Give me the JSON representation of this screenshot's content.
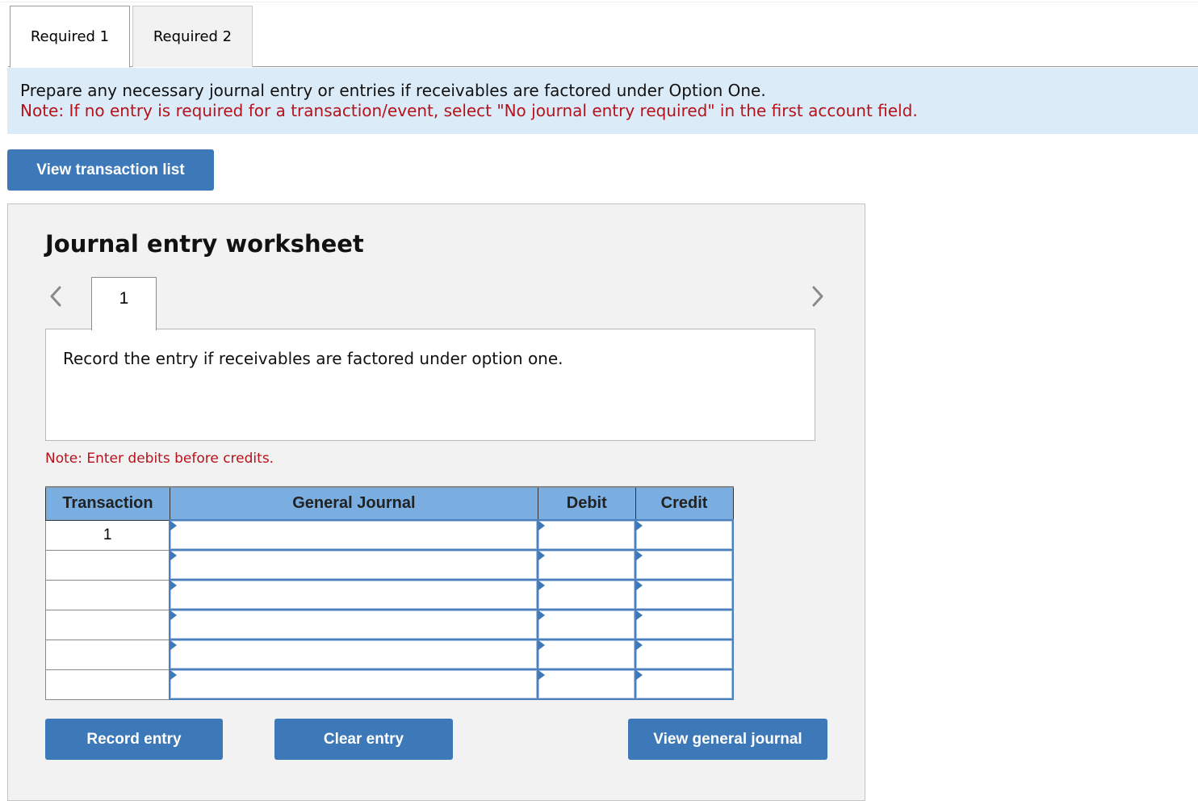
{
  "tabs": [
    {
      "label": "Required 1",
      "active": true
    },
    {
      "label": "Required 2",
      "active": false
    }
  ],
  "instructions": {
    "main": "Prepare any necessary journal entry or entries if receivables are factored under Option One.",
    "note": "Note: If no entry is required for a transaction/event, select \"No journal entry required\" in the first account field."
  },
  "buttons": {
    "view_transaction_list": "View transaction list",
    "record_entry": "Record entry",
    "clear_entry": "Clear entry",
    "view_general_journal": "View general journal"
  },
  "worksheet": {
    "title": "Journal entry worksheet",
    "current_page": "1",
    "description": "Record the entry if receivables are factored under option one.",
    "note": "Note: Enter debits before credits."
  },
  "table": {
    "headers": [
      "Transaction",
      "General Journal",
      "Debit",
      "Credit"
    ],
    "rows": [
      {
        "transaction": "1",
        "account": "",
        "debit": "",
        "credit": ""
      },
      {
        "transaction": "",
        "account": "",
        "debit": "",
        "credit": ""
      },
      {
        "transaction": "",
        "account": "",
        "debit": "",
        "credit": ""
      },
      {
        "transaction": "",
        "account": "",
        "debit": "",
        "credit": ""
      },
      {
        "transaction": "",
        "account": "",
        "debit": "",
        "credit": ""
      },
      {
        "transaction": "",
        "account": "",
        "debit": "",
        "credit": ""
      }
    ]
  },
  "icons": {
    "prev": "chevron-left-icon",
    "next": "chevron-right-icon",
    "cell_flag": "dropdown-flag-icon"
  },
  "colors": {
    "button_blue": "#3d78b8",
    "header_blue": "#7aaee0",
    "note_red": "#b5121b",
    "instruction_bg": "#dbebf8"
  }
}
